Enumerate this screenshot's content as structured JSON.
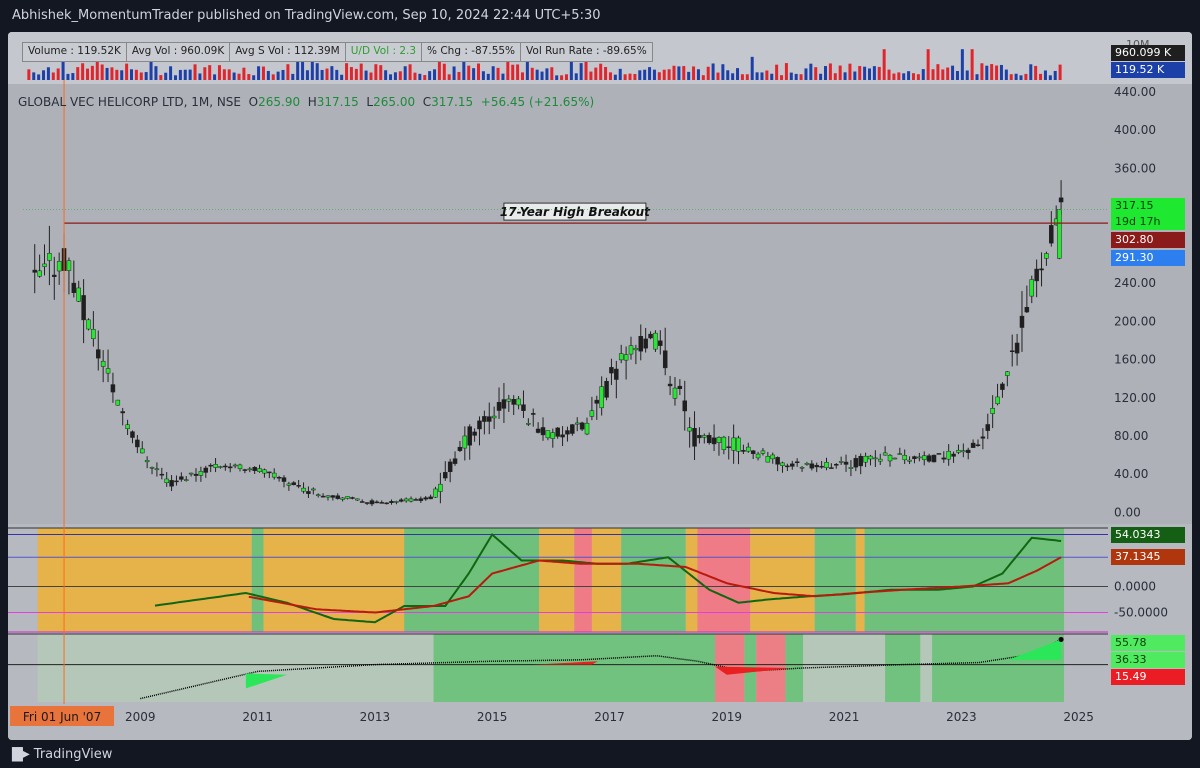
{
  "header": {
    "publisher_text": "Abhishek_MomentumTrader published on TradingView.com, Sep 10, 2024 22:44 UTC+5:30"
  },
  "stats_bar": [
    {
      "label": "Volume : 119.52K",
      "color": "#222222"
    },
    {
      "label": "Avg Vol : 960.09K",
      "color": "#222222"
    },
    {
      "label": "Avg S Vol : 112.39M",
      "color": "#222222"
    },
    {
      "label": "U/D Vol : 2.3",
      "color": "#2e9e2e"
    },
    {
      "label": "% Chg : -87.55%",
      "color": "#222222"
    },
    {
      "label": "Vol Run Rate : -89.65%",
      "color": "#222222"
    }
  ],
  "legend": {
    "symbol": "GLOBAL VEC HELICORP LTD, 1M, NSE",
    "o_label": "O",
    "o_value": "265.90",
    "h_label": "H",
    "h_value": "317.15",
    "l_label": "L",
    "l_value": "265.00",
    "c_label": "C",
    "c_value": "317.15",
    "change": "+56.45 (+21.65%)"
  },
  "footer": {
    "brand": "TradingView"
  },
  "colors": {
    "up": "#26e831",
    "down": "#1f1f1f",
    "resistance": "#8b1a1a",
    "cursor": "#ff6a1a",
    "volume_up": "#1c3fa8",
    "volume_down": "#e0262c"
  },
  "chart_data": [
    {
      "type": "candlestick",
      "title": "GLOBAL VEC HELICORP LTD, 1M, NSE",
      "x_axis": {
        "labels": [
          "2009",
          "2011",
          "2013",
          "2015",
          "2017",
          "2019",
          "2021",
          "2023",
          "2025"
        ],
        "range": [
          2007.0,
          2025.5
        ]
      },
      "y_axis": {
        "range": [
          -10,
          440
        ],
        "labels": [
          "0.00",
          "40.00",
          "80.00",
          "120.00",
          "160.00",
          "200.00",
          "240.00",
          "302.80",
          "360.00",
          "400.00",
          "440.00"
        ]
      },
      "ohlc_anchors": [
        {
          "t": 2007.2,
          "o": 180,
          "h": 300,
          "l": 155,
          "c": 240
        },
        {
          "t": 2007.7,
          "o": 240,
          "h": 330,
          "l": 200,
          "c": 270
        },
        {
          "t": 2008.1,
          "o": 270,
          "h": 300,
          "l": 180,
          "c": 200
        },
        {
          "t": 2008.6,
          "o": 200,
          "h": 210,
          "l": 110,
          "c": 120
        },
        {
          "t": 2009.0,
          "o": 120,
          "h": 125,
          "l": 60,
          "c": 65
        },
        {
          "t": 2009.5,
          "o": 65,
          "h": 70,
          "l": 25,
          "c": 30
        },
        {
          "t": 2010.3,
          "o": 30,
          "h": 65,
          "l": 25,
          "c": 50
        },
        {
          "t": 2011.0,
          "o": 50,
          "h": 60,
          "l": 40,
          "c": 45
        },
        {
          "t": 2012.0,
          "o": 45,
          "h": 50,
          "l": 15,
          "c": 20
        },
        {
          "t": 2013.0,
          "o": 20,
          "h": 28,
          "l": 8,
          "c": 10
        },
        {
          "t": 2014.0,
          "o": 10,
          "h": 22,
          "l": 8,
          "c": 15
        },
        {
          "t": 2014.6,
          "o": 15,
          "h": 90,
          "l": 12,
          "c": 80
        },
        {
          "t": 2015.3,
          "o": 80,
          "h": 140,
          "l": 40,
          "c": 120
        },
        {
          "t": 2016.0,
          "o": 120,
          "h": 145,
          "l": 70,
          "c": 80
        },
        {
          "t": 2016.6,
          "o": 80,
          "h": 110,
          "l": 60,
          "c": 90
        },
        {
          "t": 2017.3,
          "o": 90,
          "h": 180,
          "l": 80,
          "c": 170
        },
        {
          "t": 2017.8,
          "o": 170,
          "h": 205,
          "l": 140,
          "c": 180
        },
        {
          "t": 2018.5,
          "o": 180,
          "h": 185,
          "l": 60,
          "c": 75
        },
        {
          "t": 2019.2,
          "o": 75,
          "h": 130,
          "l": 50,
          "c": 70
        },
        {
          "t": 2020.0,
          "o": 70,
          "h": 75,
          "l": 30,
          "c": 50
        },
        {
          "t": 2021.0,
          "o": 50,
          "h": 65,
          "l": 38,
          "c": 50
        },
        {
          "t": 2021.8,
          "o": 50,
          "h": 90,
          "l": 40,
          "c": 60
        },
        {
          "t": 2022.5,
          "o": 60,
          "h": 75,
          "l": 40,
          "c": 55
        },
        {
          "t": 2023.3,
          "o": 55,
          "h": 80,
          "l": 45,
          "c": 70
        },
        {
          "t": 2023.8,
          "o": 70,
          "h": 150,
          "l": 65,
          "c": 140
        },
        {
          "t": 2024.3,
          "o": 140,
          "h": 260,
          "l": 130,
          "c": 250
        },
        {
          "t": 2024.67,
          "o": 265.9,
          "h": 317.15,
          "l": 265.0,
          "c": 317.15
        }
      ],
      "horizontal_lines": [
        {
          "value": 302.8,
          "start": 2007.7,
          "label": "17-Year High Breakout"
        }
      ],
      "price_labels": [
        {
          "value": 317.15,
          "text": "317.15",
          "color": "#1fe831",
          "text_color": "#0a3d0a"
        },
        {
          "value": 303.5,
          "text": "19d 17h",
          "color": "#1fe831",
          "text_color": "#0a3d0a"
        },
        {
          "value": 302.8,
          "text": "302.80",
          "color": "#8b1a1a",
          "text_color": "#ffffff"
        },
        {
          "value": 291.3,
          "text": "291.30",
          "color": "#2d7ff0",
          "text_color": "#ffffff"
        }
      ],
      "x_cursor": {
        "t": 2007.7,
        "label": "Fri 01 Jun '07"
      }
    },
    {
      "type": "bar",
      "title": "Volume",
      "y_axis": {
        "labels": [
          "10M"
        ]
      },
      "price_labels": [
        {
          "value": 960099,
          "text": "960.099 K",
          "color": "#1f1f1f"
        },
        {
          "value": 119520,
          "text": "119.52 K",
          "color": "#1c3fa8"
        }
      ]
    },
    {
      "type": "line",
      "title": "Oscillator 1",
      "y_axis": {
        "range": [
          -70,
          90
        ],
        "labels": [
          "54.0343",
          "37.1345",
          "0.0000",
          "-50.0000"
        ]
      },
      "horizontal_lines": [
        80,
        45,
        0,
        -40,
        -70
      ],
      "series": [
        {
          "key": "fast",
          "color": "#116611",
          "anchors": [
            [
              2007.5,
              null
            ],
            [
              2009.2,
              -30
            ],
            [
              2010.0,
              -20
            ],
            [
              2010.8,
              -10
            ],
            [
              2011.5,
              -25
            ],
            [
              2012.3,
              -50
            ],
            [
              2013.0,
              -55
            ],
            [
              2013.5,
              -30
            ],
            [
              2014.2,
              -30
            ],
            [
              2014.6,
              20
            ],
            [
              2015.0,
              80
            ],
            [
              2015.5,
              40
            ],
            [
              2016.2,
              40
            ],
            [
              2016.8,
              35
            ],
            [
              2017.3,
              35
            ],
            [
              2018.0,
              45
            ],
            [
              2018.7,
              -5
            ],
            [
              2019.2,
              -25
            ],
            [
              2019.7,
              -20
            ],
            [
              2020.4,
              -15
            ],
            [
              2021.0,
              -12
            ],
            [
              2021.8,
              -5
            ],
            [
              2022.6,
              -5
            ],
            [
              2023.2,
              0
            ],
            [
              2023.7,
              20
            ],
            [
              2024.2,
              75
            ],
            [
              2024.7,
              70
            ]
          ]
        },
        {
          "key": "slow",
          "color": "#b81a0d",
          "anchors": [
            [
              2007.5,
              null
            ],
            [
              2010.8,
              -15
            ],
            [
              2012.0,
              -35
            ],
            [
              2013.0,
              -40
            ],
            [
              2014.0,
              -30
            ],
            [
              2014.6,
              -15
            ],
            [
              2015.0,
              20
            ],
            [
              2015.8,
              40
            ],
            [
              2016.5,
              35
            ],
            [
              2017.5,
              35
            ],
            [
              2018.3,
              30
            ],
            [
              2019.0,
              5
            ],
            [
              2019.8,
              -10
            ],
            [
              2020.5,
              -15
            ],
            [
              2021.2,
              -10
            ],
            [
              2022.0,
              -5
            ],
            [
              2023.0,
              0
            ],
            [
              2023.8,
              5
            ],
            [
              2024.3,
              25
            ],
            [
              2024.7,
              45
            ]
          ]
        }
      ],
      "zones": [
        {
          "from": 2007.25,
          "to": 2010.9,
          "color": "#e6b24a"
        },
        {
          "from": 2010.9,
          "to": 2011.1,
          "color": "#6ec07a"
        },
        {
          "from": 2011.1,
          "to": 2013.5,
          "color": "#e6b24a"
        },
        {
          "from": 2013.5,
          "to": 2015.8,
          "color": "#6ec07a"
        },
        {
          "from": 2015.8,
          "to": 2016.4,
          "color": "#e6b24a"
        },
        {
          "from": 2016.4,
          "to": 2016.7,
          "color": "#ee7b85"
        },
        {
          "from": 2016.7,
          "to": 2017.2,
          "color": "#e6b24a"
        },
        {
          "from": 2017.2,
          "to": 2018.3,
          "color": "#6ec07a"
        },
        {
          "from": 2018.3,
          "to": 2018.5,
          "color": "#e6b24a"
        },
        {
          "from": 2018.5,
          "to": 2019.4,
          "color": "#ee7b85"
        },
        {
          "from": 2019.4,
          "to": 2020.5,
          "color": "#e6b24a"
        },
        {
          "from": 2020.5,
          "to": 2021.2,
          "color": "#6ec07a"
        },
        {
          "from": 2021.2,
          "to": 2021.35,
          "color": "#e6b24a"
        },
        {
          "from": 2021.35,
          "to": 2024.75,
          "color": "#6ec07a"
        }
      ],
      "price_labels": [
        {
          "value": 80,
          "text": "54.0343",
          "color": "#155f15",
          "text_color": "#ffffff"
        },
        {
          "value": 45,
          "text": "37.1345",
          "color": "#b0360d",
          "text_color": "#ffffff"
        },
        {
          "value": 0,
          "text": "0.0000"
        },
        {
          "value": -40,
          "text": "-50.0000"
        }
      ]
    },
    {
      "type": "area",
      "title": "Oscillator 2",
      "y_axis": {
        "labels": [
          "55.78",
          "36.33",
          "15.49"
        ]
      },
      "horizontal_lines": [
        55
      ],
      "series": [
        {
          "key": "trend",
          "color": "#000000",
          "anchors": [
            [
              2009.0,
              5
            ],
            [
              2010.0,
              25
            ],
            [
              2011.0,
              45
            ],
            [
              2013.0,
              55
            ],
            [
              2015.0,
              60
            ],
            [
              2016.5,
              62
            ],
            [
              2017.8,
              68
            ],
            [
              2018.5,
              60
            ],
            [
              2019.3,
              45
            ],
            [
              2020.3,
              50
            ],
            [
              2022.0,
              55
            ],
            [
              2023.3,
              58
            ],
            [
              2024.2,
              70
            ],
            [
              2024.7,
              92
            ]
          ]
        }
      ],
      "zones": [
        {
          "from": 2007.25,
          "to": 2014.0,
          "color": "#b5c7b8"
        },
        {
          "from": 2014.0,
          "to": 2018.8,
          "color": "#72c27f"
        },
        {
          "from": 2018.8,
          "to": 2019.3,
          "color": "#ec7f85"
        },
        {
          "from": 2019.3,
          "to": 2019.5,
          "color": "#72c27f"
        },
        {
          "from": 2019.5,
          "to": 2020.0,
          "color": "#ec7f85"
        },
        {
          "from": 2020.0,
          "to": 2020.3,
          "color": "#72c27f"
        },
        {
          "from": 2020.3,
          "to": 2021.7,
          "color": "#b5c7b8"
        },
        {
          "from": 2021.7,
          "to": 2022.3,
          "color": "#72c27f"
        },
        {
          "from": 2022.3,
          "to": 2022.5,
          "color": "#b5c7b8"
        },
        {
          "from": 2022.5,
          "to": 2024.75,
          "color": "#72c27f"
        }
      ],
      "price_labels": [
        {
          "value": 85,
          "text": "55.78",
          "color": "#4fea5f",
          "text_color": "#0a3d0a"
        },
        {
          "value": 60,
          "text": "36.33",
          "color": "#4fea5f",
          "text_color": "#0a3d0a"
        },
        {
          "value": 35,
          "text": "15.49",
          "color": "#ec1c24",
          "text_color": "#ffffff"
        }
      ]
    }
  ]
}
